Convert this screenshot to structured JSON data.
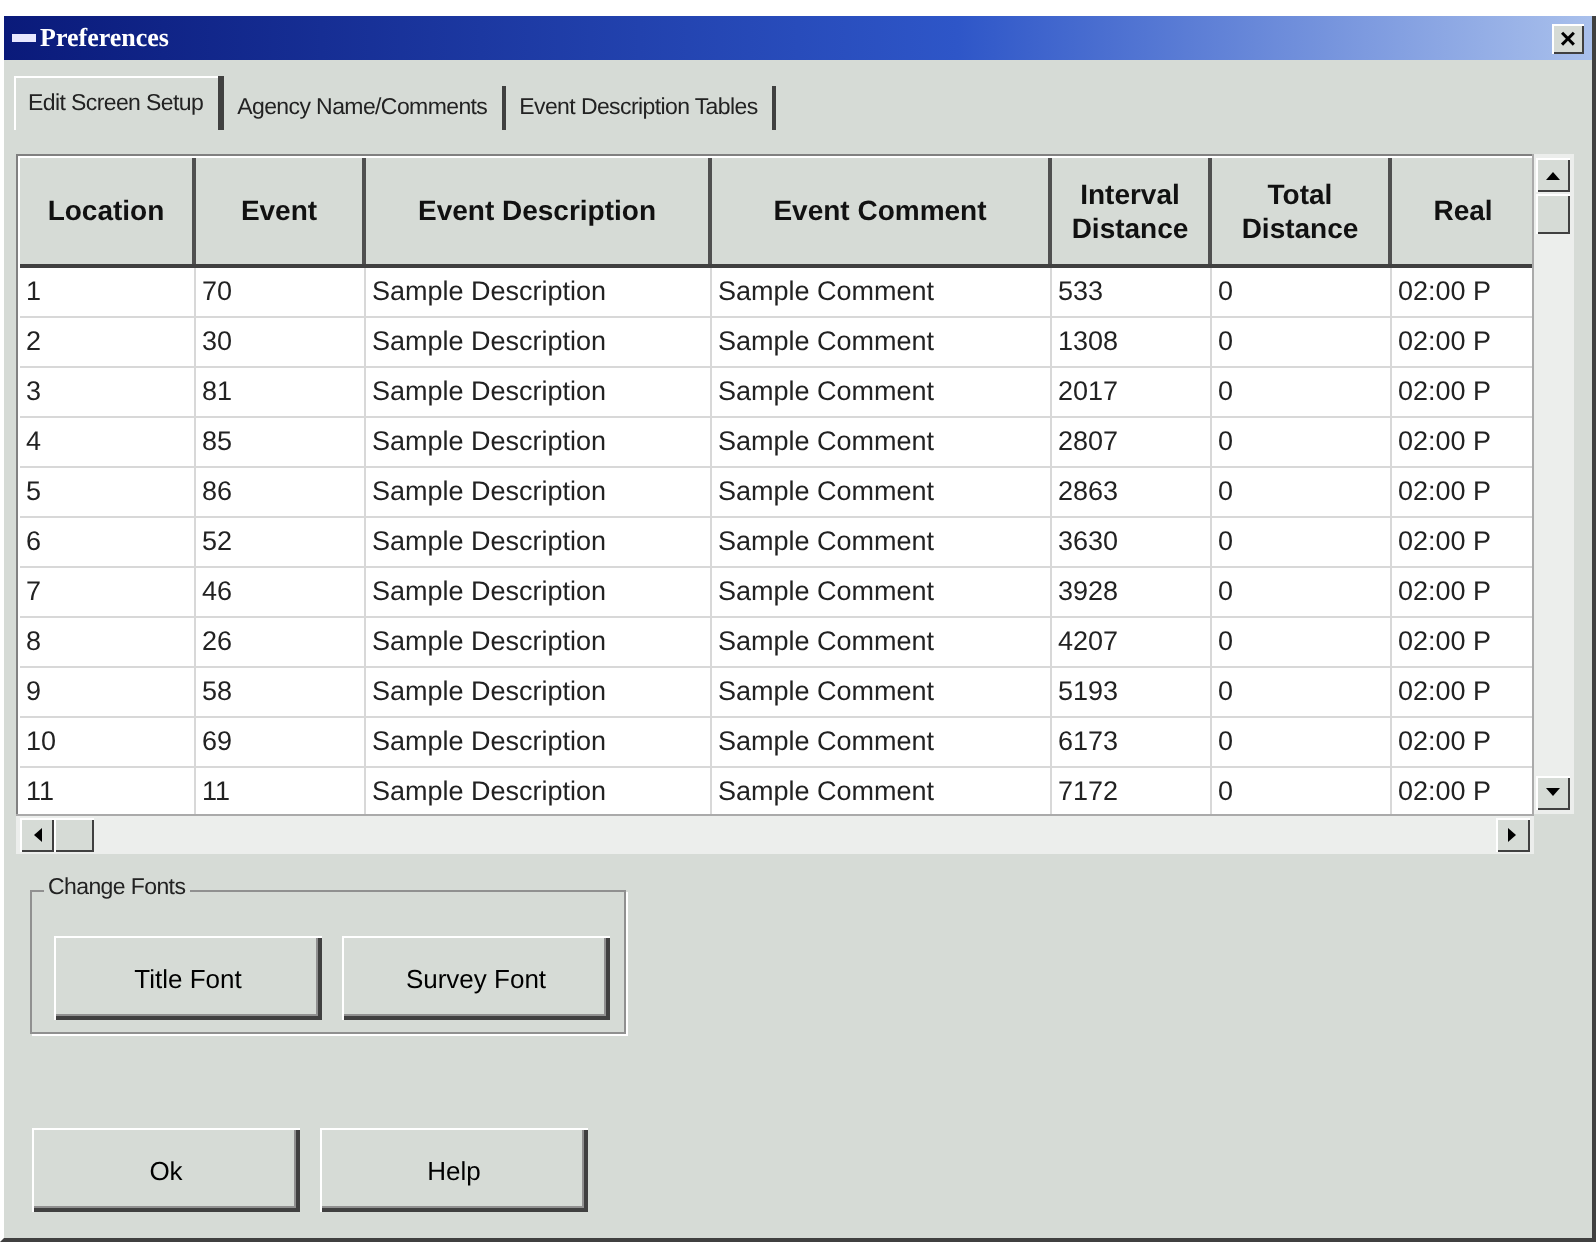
{
  "window": {
    "title": "Preferences",
    "close": "×"
  },
  "tabs": [
    {
      "label": "Edit Screen Setup",
      "selected": true
    },
    {
      "label": "Agency Name/Comments",
      "selected": false
    },
    {
      "label": "Event Description Tables",
      "selected": false
    }
  ],
  "table": {
    "columns": [
      "Location",
      "Event",
      "Event Description",
      "Event Comment",
      "Interval Distance",
      "Total Distance",
      "Real"
    ],
    "rows": [
      [
        "1",
        "70",
        "Sample Description",
        "Sample Comment",
        "533",
        "0",
        "02:00 P"
      ],
      [
        "2",
        "30",
        "Sample Description",
        "Sample Comment",
        "1308",
        "0",
        "02:00 P"
      ],
      [
        "3",
        "81",
        "Sample Description",
        "Sample Comment",
        "2017",
        "0",
        "02:00 P"
      ],
      [
        "4",
        "85",
        "Sample Description",
        "Sample Comment",
        "2807",
        "0",
        "02:00 P"
      ],
      [
        "5",
        "86",
        "Sample Description",
        "Sample Comment",
        "2863",
        "0",
        "02:00 P"
      ],
      [
        "6",
        "52",
        "Sample Description",
        "Sample Comment",
        "3630",
        "0",
        "02:00 P"
      ],
      [
        "7",
        "46",
        "Sample Description",
        "Sample Comment",
        "3928",
        "0",
        "02:00 P"
      ],
      [
        "8",
        "26",
        "Sample Description",
        "Sample Comment",
        "4207",
        "0",
        "02:00 P"
      ],
      [
        "9",
        "58",
        "Sample Description",
        "Sample Comment",
        "5193",
        "0",
        "02:00 P"
      ],
      [
        "10",
        "69",
        "Sample Description",
        "Sample Comment",
        "6173",
        "0",
        "02:00 P"
      ],
      [
        "11",
        "11",
        "Sample Description",
        "Sample Comment",
        "7172",
        "0",
        "02:00 P"
      ]
    ]
  },
  "font_group": {
    "title": "Change Fonts",
    "buttons": [
      "Title Font",
      "Survey Font"
    ]
  },
  "buttons": [
    "Ok",
    "Help"
  ]
}
